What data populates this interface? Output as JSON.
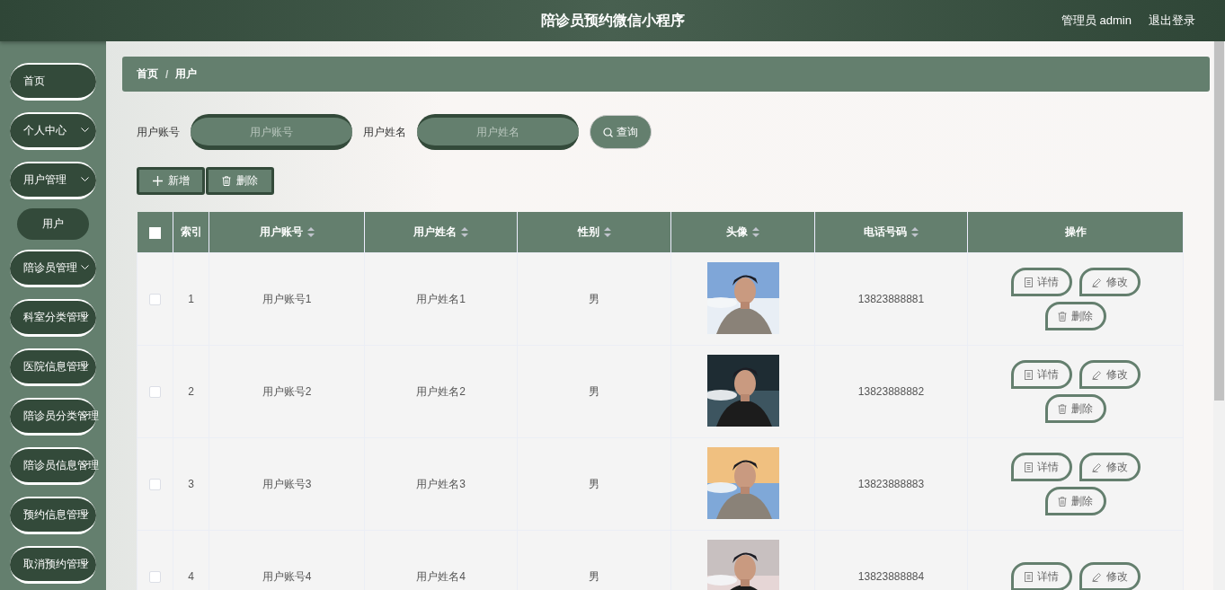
{
  "header": {
    "title": "陪诊员预约微信小程序",
    "user": "管理员 admin",
    "logout": "退出登录"
  },
  "sidebar": {
    "items": [
      {
        "label": "首页",
        "kind": "link"
      },
      {
        "label": "个人中心",
        "kind": "menu"
      },
      {
        "label": "用户管理",
        "kind": "menu",
        "children": [
          {
            "label": "用户"
          }
        ]
      },
      {
        "label": "陪诊员管理",
        "kind": "menu"
      },
      {
        "label": "科室分类管理",
        "kind": "menu"
      },
      {
        "label": "医院信息管理",
        "kind": "menu"
      },
      {
        "label": "陪诊员分类管理",
        "kind": "menu"
      },
      {
        "label": "陪诊员信息管理",
        "kind": "menu"
      },
      {
        "label": "预约信息管理",
        "kind": "menu"
      },
      {
        "label": "取消预约管理",
        "kind": "menu"
      }
    ]
  },
  "breadcrumb": {
    "items": [
      "首页",
      "用户"
    ],
    "separator": "/"
  },
  "search": {
    "fields": [
      {
        "label": "用户账号",
        "placeholder": "用户账号"
      },
      {
        "label": "用户姓名",
        "placeholder": "用户姓名"
      }
    ],
    "button": "查询"
  },
  "actions": [
    {
      "label": "新增",
      "kind": "add"
    },
    {
      "label": "删除",
      "kind": "delete"
    }
  ],
  "table": {
    "select_all": false,
    "columns": [
      {
        "label": "索引",
        "sortable": false
      },
      {
        "label": "用户账号",
        "sortable": true
      },
      {
        "label": "用户姓名",
        "sortable": true
      },
      {
        "label": "性别",
        "sortable": true
      },
      {
        "label": "头像",
        "sortable": true
      },
      {
        "label": "电话号码",
        "sortable": true
      },
      {
        "label": "操作",
        "sortable": false
      }
    ],
    "rows": [
      {
        "checked": false,
        "index": "1",
        "account": "用户账号1",
        "name": "用户姓名1",
        "gender": "男",
        "avatar": {
          "kind": "picture"
        },
        "phone": "13823888881",
        "actions": [
          {
            "label": "详情",
            "kind": "detail"
          },
          {
            "label": "修改",
            "kind": "edit"
          },
          {
            "label": "删除",
            "kind": "delete"
          }
        ]
      },
      {
        "checked": false,
        "index": "2",
        "account": "用户账号2",
        "name": "用户姓名2",
        "gender": "男",
        "avatar": {
          "kind": "picture"
        },
        "phone": "13823888882",
        "actions": [
          {
            "label": "详情",
            "kind": "detail"
          },
          {
            "label": "修改",
            "kind": "edit"
          },
          {
            "label": "删除",
            "kind": "delete"
          }
        ]
      },
      {
        "checked": false,
        "index": "3",
        "account": "用户账号3",
        "name": "用户姓名3",
        "gender": "男",
        "avatar": {
          "kind": "picture"
        },
        "phone": "13823888883",
        "actions": [
          {
            "label": "详情",
            "kind": "detail"
          },
          {
            "label": "修改",
            "kind": "edit"
          },
          {
            "label": "删除",
            "kind": "delete"
          }
        ]
      },
      {
        "checked": false,
        "index": "4",
        "account": "用户账号4",
        "name": "用户姓名4",
        "gender": "男",
        "avatar": {
          "kind": "picture"
        },
        "phone": "13823888884",
        "actions": [
          {
            "label": "详情",
            "kind": "detail"
          },
          {
            "label": "修改",
            "kind": "edit"
          }
        ]
      }
    ]
  }
}
